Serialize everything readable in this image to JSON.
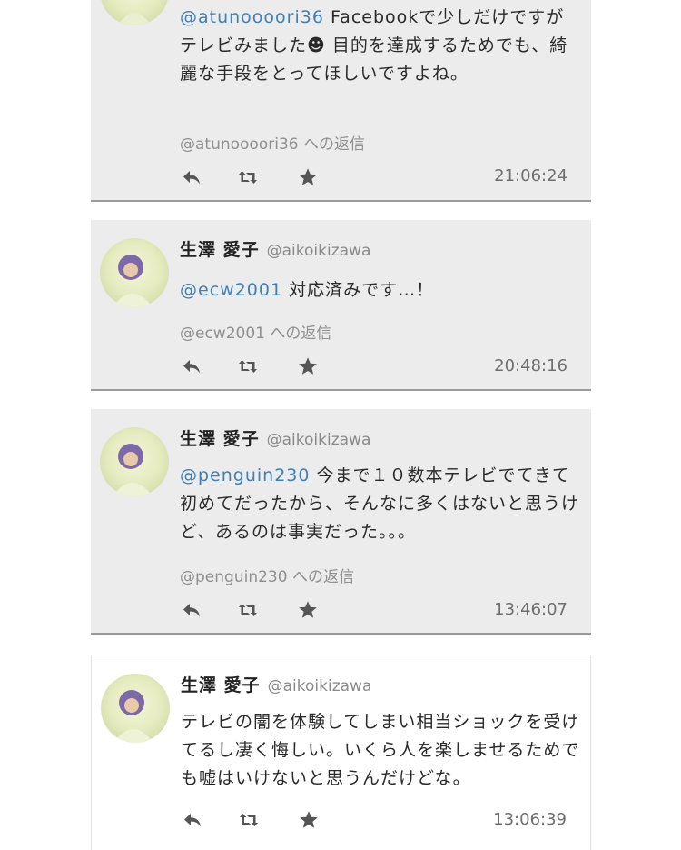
{
  "tweets": [
    {
      "user_name": "",
      "handle": "",
      "mention": "@atunoooori36",
      "text": " Facebookで少しだけですがテレビみました☻ 目的を達成するためでも、綺麗な手段をとってほしいですよね。",
      "reply_to": "@atunoooori36 への返信",
      "time": "21:06:24"
    },
    {
      "user_name": "生澤 愛子",
      "handle": "@aikoikizawa",
      "mention": "@ecw2001",
      "text": " 対応済みです…！",
      "reply_to": "@ecw2001 への返信",
      "time": "20:48:16"
    },
    {
      "user_name": "生澤 愛子",
      "handle": "@aikoikizawa",
      "mention": "@penguin230",
      "text": " 今まで１０数本テレビでてきて初めてだったから、そんなに多くはないと思うけど、あるのは事実だった。。。",
      "reply_to": "@penguin230 への返信",
      "time": "13:46:07"
    },
    {
      "user_name": "生澤 愛子",
      "handle": "@aikoikizawa",
      "mention": "",
      "text": "テレビの闇を体験してしまい相当ショックを受けてるし凄く悔しい。いくら人を楽しませるためでも嘘はいけないと思うんだけどな。",
      "reply_to": "",
      "time": "13:06:39"
    }
  ],
  "icons": {
    "reply": "reply-icon",
    "retweet": "retweet-icon",
    "favorite": "star-icon"
  },
  "colors": {
    "card_bg": "#ececec",
    "mention": "#3f7fb5",
    "icon": "#555555"
  }
}
